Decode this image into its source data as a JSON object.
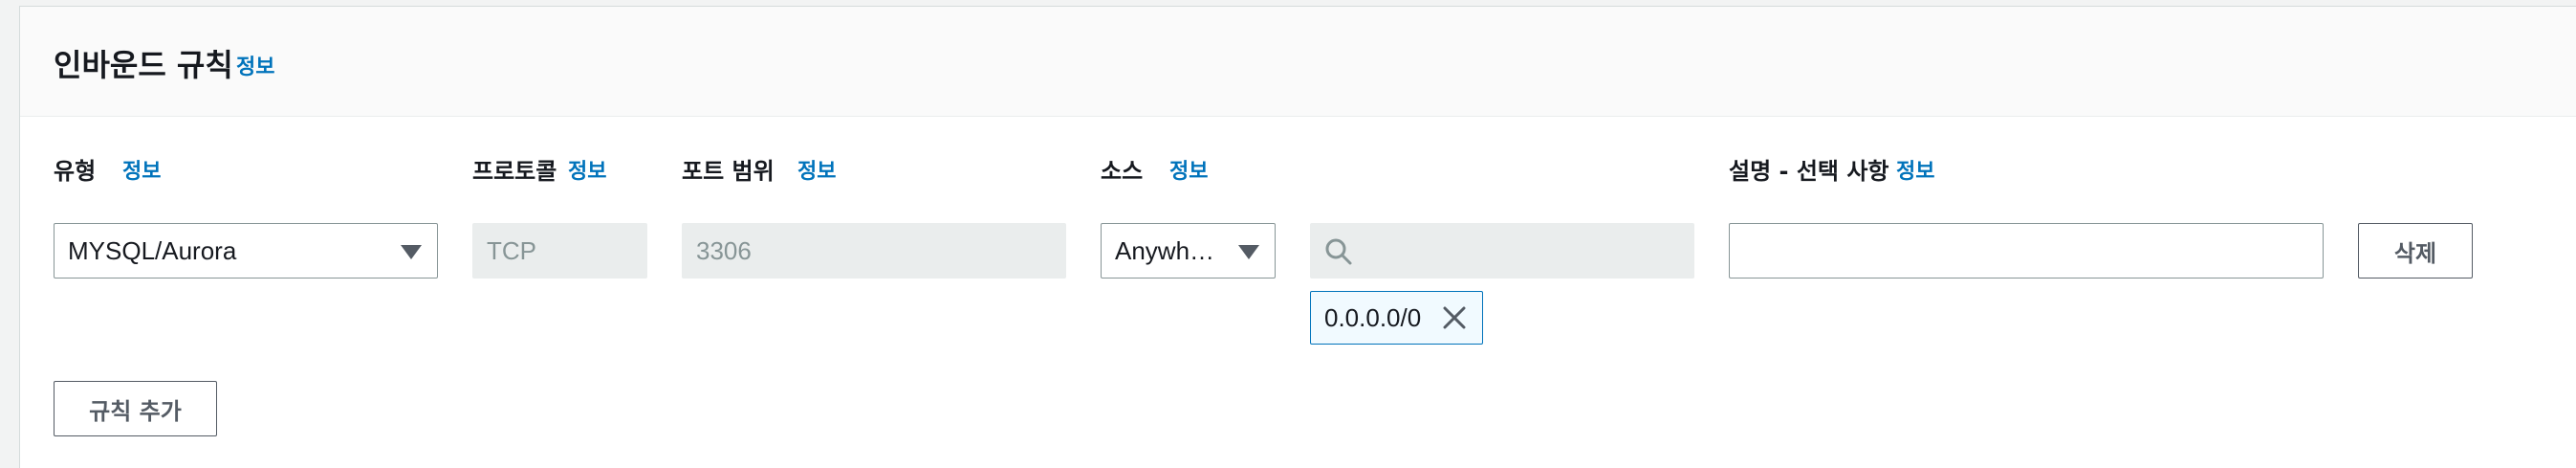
{
  "panel": {
    "title": "인바운드 규칙",
    "title_info": "정보"
  },
  "columns": {
    "type": {
      "label": "유형",
      "info": "정보"
    },
    "protocol": {
      "label": "프로토콜",
      "info": "정보"
    },
    "port_range": {
      "label": "포트 범위",
      "info": "정보"
    },
    "source": {
      "label": "소스",
      "info": "정보"
    },
    "description": {
      "label": "설명 - 선택 사항",
      "info": "정보"
    }
  },
  "rule": {
    "type_value": "MYSQL/Aurora",
    "protocol_value": "TCP",
    "port_value": "3306",
    "source_value": "Anywh…",
    "source_search_placeholder": "",
    "source_token": "0.0.0.0/0",
    "description_value": "",
    "delete_label": "삭제"
  },
  "actions": {
    "add_rule_label": "규칙 추가"
  },
  "icons": {
    "caret": "caret-down-icon",
    "search": "search-icon",
    "remove": "close-icon"
  },
  "colors": {
    "link": "#0073bb",
    "border": "#879596",
    "disabled_bg": "#eaeded",
    "token_border": "#0073bb",
    "token_bg": "#f1faff"
  }
}
